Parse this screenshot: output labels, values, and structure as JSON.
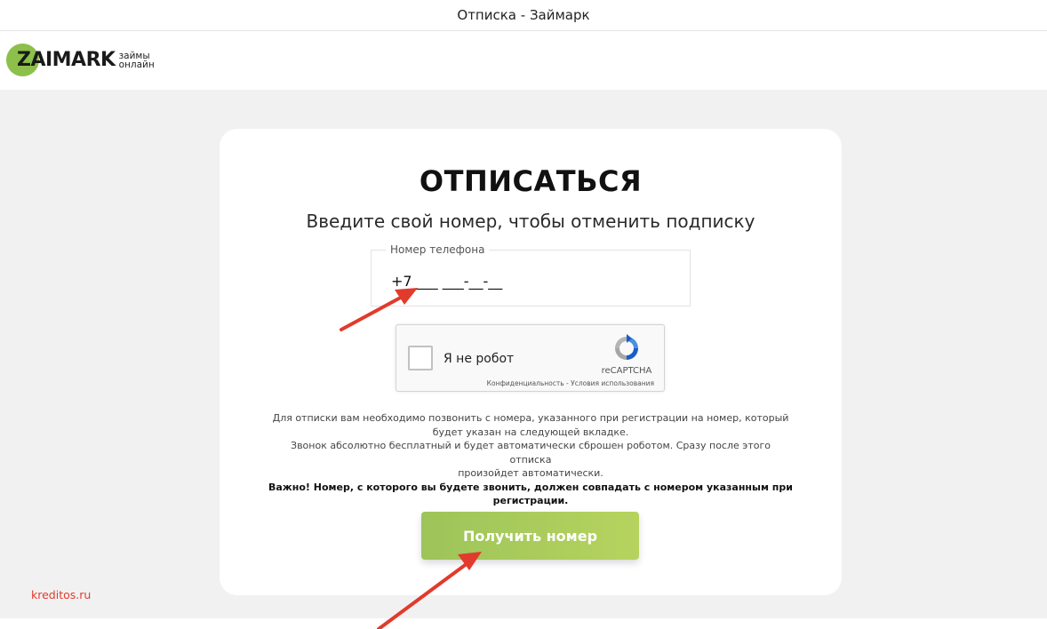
{
  "window": {
    "title": "Отписка - Займарк"
  },
  "logo": {
    "word": "ZAIMARK",
    "tag_line1": "займы",
    "tag_line2": "онлайн"
  },
  "card": {
    "title": "ОТПИСАТЬСЯ",
    "subtitle": "Введите свой номер, чтобы отменить подписку",
    "phone_label": "Номер телефона",
    "phone_value": "+7 ___ ___-__-__",
    "captcha": {
      "label": "Я не робот",
      "brand": "reCAPTCHA",
      "links": "Конфиденциальность - Условия использования"
    },
    "info_line1": "Для отписки вам необходимо позвонить с номера, указанного при регистрации на номер, который",
    "info_line2": "будет указан на следующей вкладке.",
    "info_line3": "Звонок абсолютно бесплатный и будет автоматически сброшен роботом. Сразу после этого отписка",
    "info_line4": "произойдет автоматически.",
    "important_line1": "Важно! Номер, с которого вы будете звонить, должен совпадать с номером указанным при",
    "important_line2": "регистрации.",
    "cta_label": "Получить номер"
  },
  "watermark": "kreditos.ru",
  "colors": {
    "accent": "#9dc45a",
    "logo_dot": "#8cc04a",
    "arrow": "#e23a2c",
    "background": "#f2f1f1"
  }
}
